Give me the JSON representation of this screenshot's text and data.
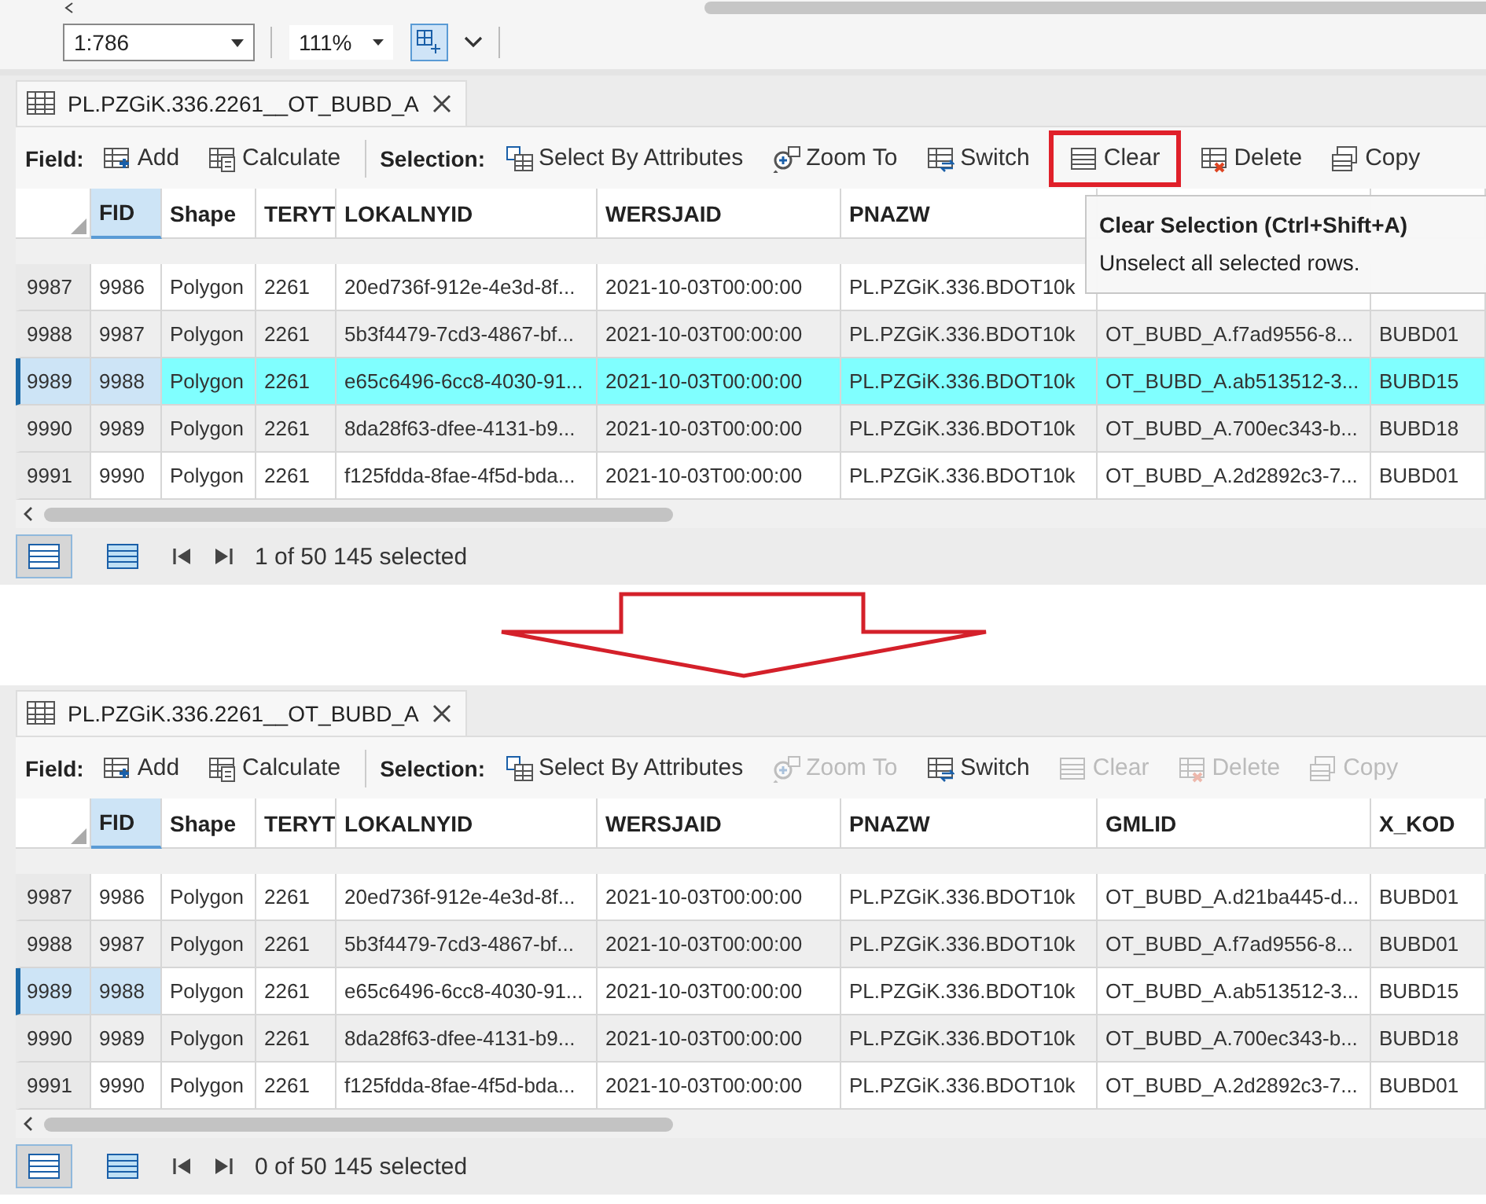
{
  "map_toolbar": {
    "scale": "1:786",
    "zoom": "111%"
  },
  "panels": [
    {
      "tab_title": "PL.PZGiK.336.2261__OT_BUBD_A",
      "field_label": "Field:",
      "field_buttons": [
        {
          "kind": "add",
          "label": "Add",
          "disabled": false
        },
        {
          "kind": "calculate",
          "label": "Calculate",
          "disabled": false
        }
      ],
      "selection_label": "Selection:",
      "selection_buttons": [
        {
          "kind": "select",
          "label": "Select By Attributes",
          "disabled": false,
          "highlighted": false
        },
        {
          "kind": "zoom",
          "label": "Zoom To",
          "disabled": false,
          "highlighted": false
        },
        {
          "kind": "switch",
          "label": "Switch",
          "disabled": false,
          "highlighted": false
        },
        {
          "kind": "clear",
          "label": "Clear",
          "disabled": false,
          "highlighted": true
        },
        {
          "kind": "delete",
          "label": "Delete",
          "disabled": false,
          "highlighted": false
        },
        {
          "kind": "copy",
          "label": "Copy",
          "disabled": false,
          "highlighted": false
        }
      ],
      "tooltip": {
        "title": "Clear Selection (Ctrl+Shift+A)",
        "text": "Unselect all selected rows."
      },
      "columns": [
        {
          "label": "FID",
          "active": true
        },
        {
          "label": "Shape",
          "active": false
        },
        {
          "label": "TERYT",
          "active": false
        },
        {
          "label": "LOKALNYID",
          "active": false
        },
        {
          "label": "WERSJAID",
          "active": false
        },
        {
          "label": "PNAZW",
          "active": false
        },
        {
          "active": false
        },
        {
          "active": false
        }
      ],
      "rows": [
        {
          "number": "9987",
          "cells": [
            "9986",
            "Polygon",
            "2261",
            "20ed736f-912e-4e3d-8f...",
            "2021-10-03T00:00:00",
            "PL.PZGiK.336.BDOT10k",
            null,
            null
          ],
          "selected": false,
          "current": false
        },
        {
          "number": "9988",
          "cells": [
            "9987",
            "Polygon",
            "2261",
            "5b3f4479-7cd3-4867-bf...",
            "2021-10-03T00:00:00",
            "PL.PZGiK.336.BDOT10k",
            "OT_BUBD_A.f7ad9556-8...",
            "BUBD01"
          ],
          "selected": false,
          "current": false
        },
        {
          "number": "9989",
          "cells": [
            "9988",
            "Polygon",
            "2261",
            "e65c6496-6cc8-4030-91...",
            "2021-10-03T00:00:00",
            "PL.PZGiK.336.BDOT10k",
            "OT_BUBD_A.ab513512-3...",
            "BUBD15"
          ],
          "selected": true,
          "current": true
        },
        {
          "number": "9990",
          "cells": [
            "9989",
            "Polygon",
            "2261",
            "8da28f63-dfee-4131-b9...",
            "2021-10-03T00:00:00",
            "PL.PZGiK.336.BDOT10k",
            "OT_BUBD_A.700ec343-b...",
            "BUBD18"
          ],
          "selected": false,
          "current": false
        },
        {
          "number": "9991",
          "cells": [
            "9990",
            "Polygon",
            "2261",
            "f125fdda-8fae-4f5d-bda...",
            "2021-10-03T00:00:00",
            "PL.PZGiK.336.BDOT10k",
            "OT_BUBD_A.2d2892c3-7...",
            "BUBD01"
          ],
          "selected": false,
          "current": false
        }
      ],
      "views": [
        {
          "kind": "all",
          "selected": true
        },
        {
          "kind": "selected",
          "selected": false
        }
      ],
      "status": "1 of 50 145 selected"
    },
    {
      "tab_title": "PL.PZGiK.336.2261__OT_BUBD_A",
      "field_label": "Field:",
      "field_buttons": [
        {
          "kind": "add",
          "label": "Add",
          "disabled": false
        },
        {
          "kind": "calculate",
          "label": "Calculate",
          "disabled": false
        }
      ],
      "selection_label": "Selection:",
      "selection_buttons": [
        {
          "kind": "select",
          "label": "Select By Attributes",
          "disabled": false,
          "highlighted": false
        },
        {
          "kind": "zoom",
          "label": "Zoom To",
          "disabled": true,
          "highlighted": false
        },
        {
          "kind": "switch",
          "label": "Switch",
          "disabled": false,
          "highlighted": false
        },
        {
          "kind": "clear",
          "label": "Clear",
          "disabled": true,
          "highlighted": false
        },
        {
          "kind": "delete",
          "label": "Delete",
          "disabled": true,
          "highlighted": false
        },
        {
          "kind": "copy",
          "label": "Copy",
          "disabled": true,
          "highlighted": false
        }
      ],
      "columns": [
        {
          "label": "FID",
          "active": true
        },
        {
          "label": "Shape",
          "active": false
        },
        {
          "label": "TERYT",
          "active": false
        },
        {
          "label": "LOKALNYID",
          "active": false
        },
        {
          "label": "WERSJAID",
          "active": false
        },
        {
          "label": "PNAZW",
          "active": false
        },
        {
          "label": "GMLID",
          "active": false
        },
        {
          "label": "X_KOD",
          "active": false
        }
      ],
      "rows": [
        {
          "number": "9987",
          "cells": [
            "9986",
            "Polygon",
            "2261",
            "20ed736f-912e-4e3d-8f...",
            "2021-10-03T00:00:00",
            "PL.PZGiK.336.BDOT10k",
            "OT_BUBD_A.d21ba445-d...",
            "BUBD01"
          ],
          "selected": false,
          "current": false
        },
        {
          "number": "9988",
          "cells": [
            "9987",
            "Polygon",
            "2261",
            "5b3f4479-7cd3-4867-bf...",
            "2021-10-03T00:00:00",
            "PL.PZGiK.336.BDOT10k",
            "OT_BUBD_A.f7ad9556-8...",
            "BUBD01"
          ],
          "selected": false,
          "current": false
        },
        {
          "number": "9989",
          "cells": [
            "9988",
            "Polygon",
            "2261",
            "e65c6496-6cc8-4030-91...",
            "2021-10-03T00:00:00",
            "PL.PZGiK.336.BDOT10k",
            "OT_BUBD_A.ab513512-3...",
            "BUBD15"
          ],
          "selected": false,
          "current": true
        },
        {
          "number": "9990",
          "cells": [
            "9989",
            "Polygon",
            "2261",
            "8da28f63-dfee-4131-b9...",
            "2021-10-03T00:00:00",
            "PL.PZGiK.336.BDOT10k",
            "OT_BUBD_A.700ec343-b...",
            "BUBD18"
          ],
          "selected": false,
          "current": false
        },
        {
          "number": "9991",
          "cells": [
            "9990",
            "Polygon",
            "2261",
            "f125fdda-8fae-4f5d-bda...",
            "2021-10-03T00:00:00",
            "PL.PZGiK.336.BDOT10k",
            "OT_BUBD_A.2d2892c3-7...",
            "BUBD01"
          ],
          "selected": false,
          "current": false
        }
      ],
      "views": [
        {
          "kind": "all",
          "selected": true
        },
        {
          "kind": "selected",
          "selected": false
        }
      ],
      "status": "0 of 50 145 selected"
    }
  ]
}
